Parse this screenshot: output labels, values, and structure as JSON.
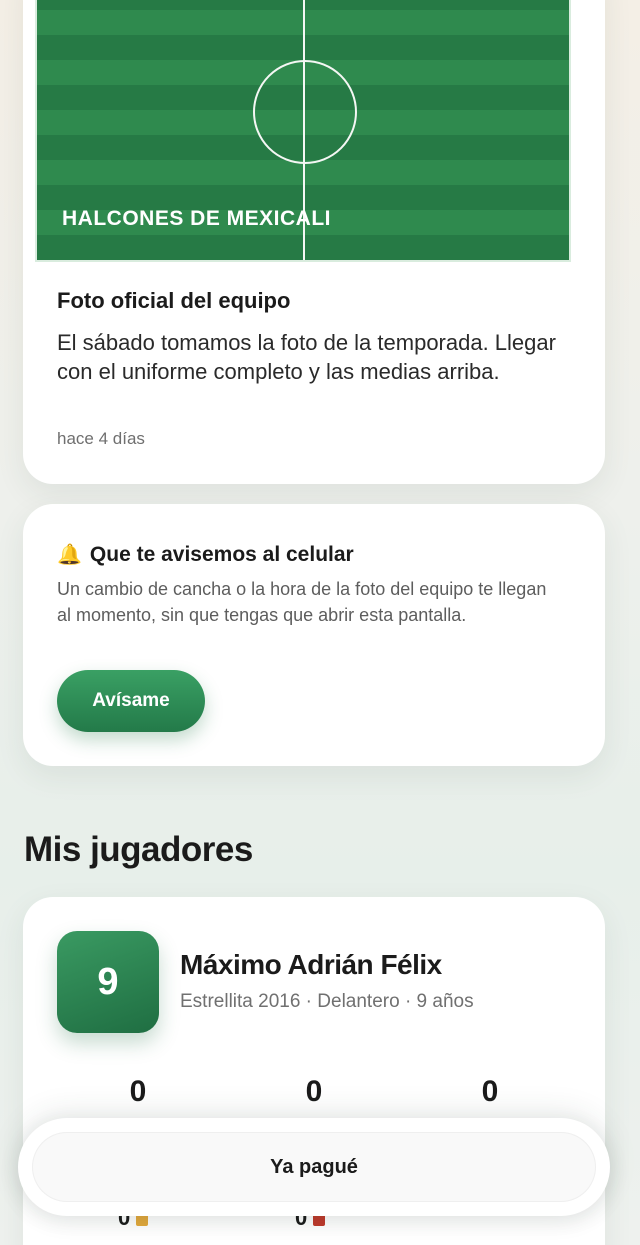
{
  "post": {
    "image_team_text": "HALCONES DE MEXICALI",
    "title": "Foto oficial del equipo",
    "body": "El sábado tomamos la foto de la temporada. Llegar con el uniforme completo y las medias arriba.",
    "time": "hace 4 días"
  },
  "notify": {
    "icon": "bell-icon",
    "title": "Que te avisemos al celular",
    "body": "Un cambio de cancha o la hora de la foto del equipo te llegan al momento, sin que tengas que abrir esta pantalla.",
    "button": "Avísame"
  },
  "section": {
    "title": "Mis jugadores"
  },
  "player": {
    "number": "9",
    "name": "Máximo Adrián Félix",
    "meta": "Estrellita 2016 · Delantero · 9 años",
    "stats": [
      "0",
      "0",
      "0"
    ],
    "yellow_cards": "0",
    "red_cards": "0"
  },
  "bottom": {
    "paid_button": "Ya pagué"
  },
  "colors": {
    "accent_green": "#2f8a4e",
    "yellow_card": "#e3a93c",
    "red_card": "#c0392b"
  }
}
